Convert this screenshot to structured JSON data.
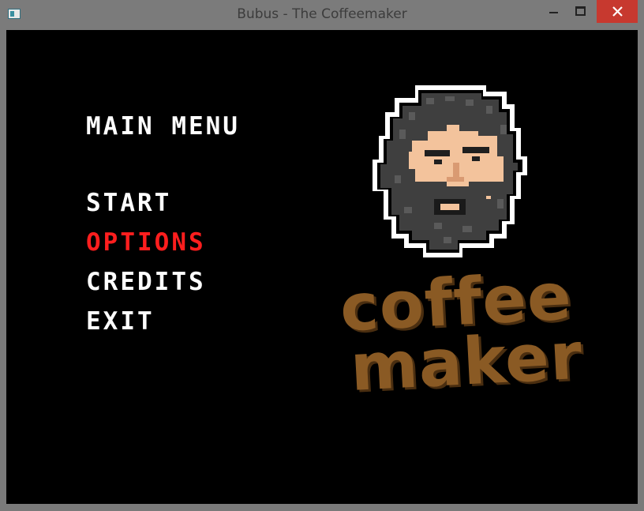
{
  "window": {
    "title": "Bubus - The Coffeemaker",
    "controls": [
      "minimize-icon",
      "maximize-icon",
      "close-icon"
    ],
    "close_color": "#c7392f"
  },
  "menu": {
    "heading": "MAIN MENU",
    "items": [
      {
        "label": "START",
        "selected": false
      },
      {
        "label": "OPTIONS",
        "selected": true
      },
      {
        "label": "CREDITS",
        "selected": false
      },
      {
        "label": "EXIT",
        "selected": false
      }
    ],
    "selected_color": "#ff1e1e",
    "text_color": "#ffffff"
  },
  "logo": {
    "line1": "coffee",
    "line2": "maker",
    "text_color": "#8a5a24",
    "icon": "bearded-face-icon"
  }
}
